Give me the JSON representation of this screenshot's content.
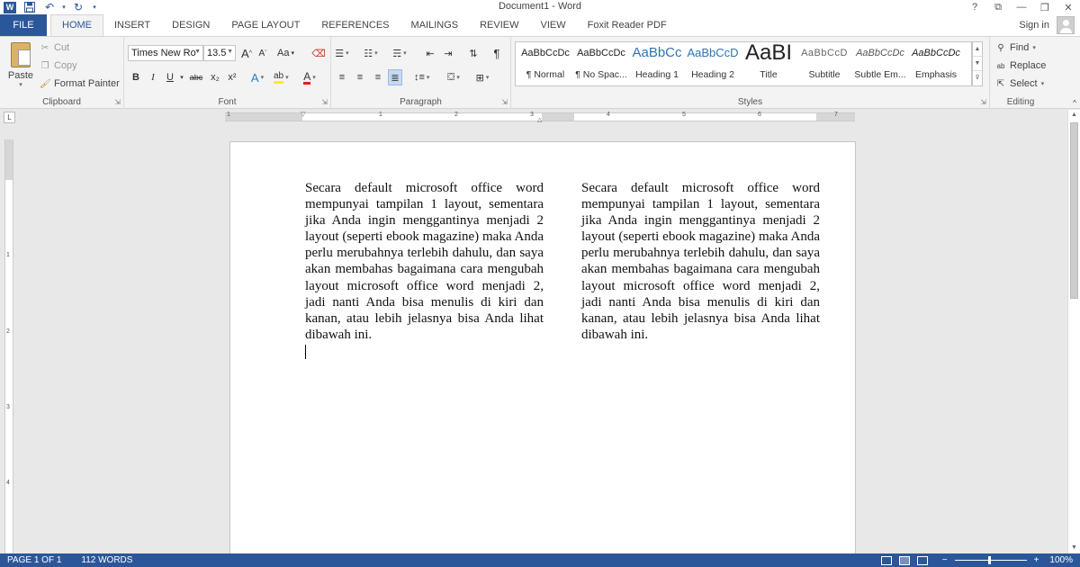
{
  "titlebar": {
    "title": "Document1 - Word",
    "help": "?",
    "ribbon_options": "⧉",
    "minimize": "—",
    "restore": "❐",
    "close": "✕"
  },
  "tabs": {
    "file": "FILE",
    "home": "HOME",
    "insert": "INSERT",
    "design": "DESIGN",
    "page_layout": "PAGE LAYOUT",
    "references": "REFERENCES",
    "mailings": "MAILINGS",
    "review": "REVIEW",
    "view": "VIEW",
    "foxit": "Foxit Reader PDF",
    "sign_in": "Sign in"
  },
  "clipboard": {
    "paste": "Paste",
    "cut": "Cut",
    "copy": "Copy",
    "format_painter": "Format Painter",
    "label": "Clipboard"
  },
  "font": {
    "name": "Times New Ro",
    "size": "13.5",
    "grow": "A",
    "shrink": "A",
    "change_case": "Aa",
    "bold": "B",
    "italic": "I",
    "underline": "U",
    "strikethrough": "abc",
    "subscript": "x₂",
    "superscript": "x²",
    "label": "Font"
  },
  "paragraph": {
    "pilcrow": "¶",
    "label": "Paragraph"
  },
  "styles": {
    "label": "Styles",
    "items": [
      {
        "sample": "AaBbCcDc",
        "name": "¶ Normal"
      },
      {
        "sample": "AaBbCcDc",
        "name": "¶ No Spac..."
      },
      {
        "sample": "AaBbCc",
        "name": "Heading 1"
      },
      {
        "sample": "AaBbCcD",
        "name": "Heading 2"
      },
      {
        "sample": "AaBI",
        "name": "Title"
      },
      {
        "sample": "AaBbCcD",
        "name": "Subtitle"
      },
      {
        "sample": "AaBbCcDc",
        "name": "Subtle Em..."
      },
      {
        "sample": "AaBbCcDc",
        "name": "Emphasis"
      }
    ]
  },
  "editing": {
    "find": "Find",
    "replace": "Replace",
    "select": "Select",
    "label": "Editing"
  },
  "ruler": {
    "h_numbers": [
      "1",
      "1",
      "2",
      "3",
      "4",
      "5",
      "6",
      "7"
    ],
    "v_numbers": [
      "1",
      "2",
      "3",
      "4"
    ]
  },
  "document": {
    "left_column": "Secara default microsoft office word mempunyai tampilan 1 layout, sementara jika Anda ingin menggantinya menjadi 2 layout (seperti ebook magazine) maka Anda perlu merubahnya terlebih dahulu, dan saya akan membahas bagaimana cara mengubah layout microsoft office word menjadi 2, jadi nanti Anda bisa menulis di kiri dan kanan, atau lebih jelasnya bisa Anda lihat dibawah ini.",
    "right_column": "Secara default microsoft office word mempunyai tampilan 1 layout, sementara jika Anda ingin menggantinya menjadi 2 layout (seperti ebook magazine) maka Anda perlu merubahnya terlebih dahulu, dan saya akan membahas bagaimana cara mengubah layout microsoft office word menjadi 2, jadi nanti Anda bisa menulis di kiri dan kanan, atau lebih jelasnya bisa Anda lihat dibawah ini."
  },
  "status": {
    "page": "PAGE 1 OF 1",
    "words": "112 WORDS",
    "zoom": "100%",
    "zoom_out": "−",
    "zoom_in": "+",
    "zoom_level": 100
  },
  "colors": {
    "accent": "#2b579a"
  }
}
